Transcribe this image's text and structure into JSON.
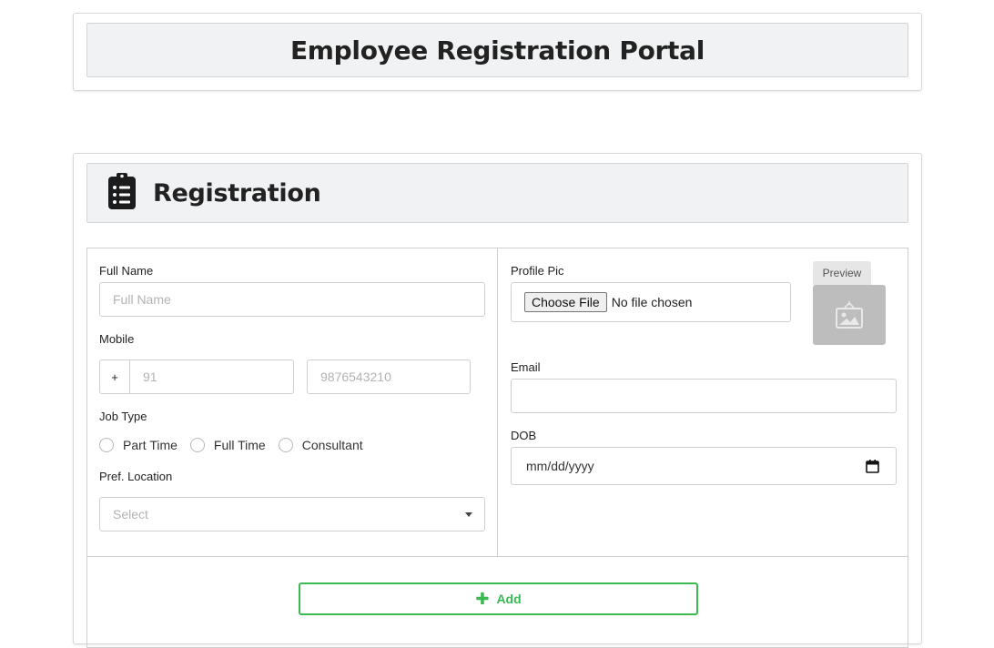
{
  "header": {
    "title": "Employee Registration Portal"
  },
  "registration": {
    "title": "Registration"
  },
  "form": {
    "full_name": {
      "label": "Full Name",
      "placeholder": "Full Name"
    },
    "mobile": {
      "label": "Mobile",
      "prefix": "+",
      "country_code_placeholder": "91",
      "number_placeholder": "9876543210"
    },
    "job_type": {
      "label": "Job Type",
      "options": [
        "Part Time",
        "Full Time",
        "Consultant"
      ]
    },
    "pref_location": {
      "label": "Pref. Location",
      "placeholder": "Select"
    },
    "profile_pic": {
      "label": "Profile Pic",
      "button": "Choose File",
      "status": "No file chosen",
      "preview_label": "Preview"
    },
    "email": {
      "label": "Email",
      "value": ""
    },
    "dob": {
      "label": "DOB",
      "placeholder": "mm/dd/yyyy"
    },
    "add_button": {
      "label": "Add",
      "color": "#3bba52"
    }
  },
  "icons": {
    "registration": "clipboard-list-icon",
    "preview": "image-placeholder-icon",
    "calendar": "calendar-icon",
    "add": "plus-icon",
    "dropdown": "caret-down-icon"
  }
}
